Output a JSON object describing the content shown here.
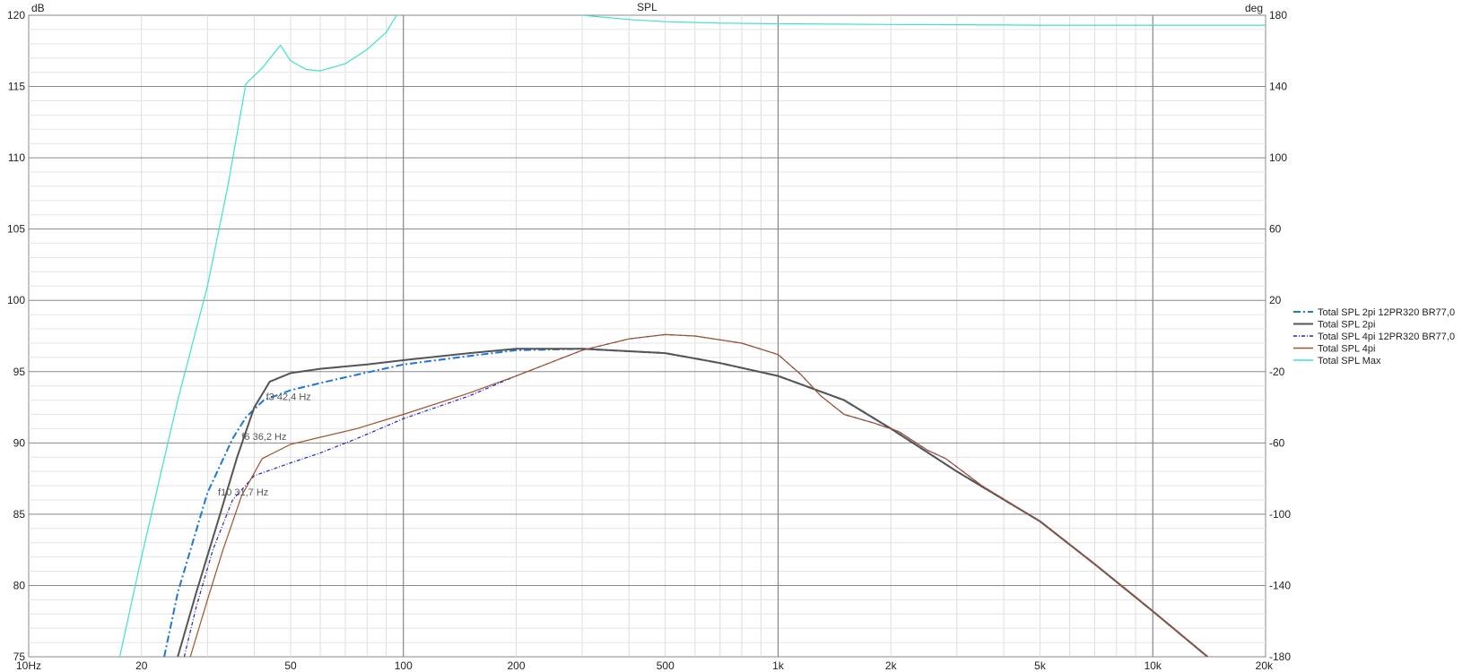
{
  "chart_data": {
    "type": "line",
    "title": "SPL",
    "ylabel": "dB",
    "y2label": "deg",
    "xscale": "log",
    "xlim": [
      10,
      20000
    ],
    "ylim": [
      75,
      120
    ],
    "y2lim": [
      -180,
      180
    ],
    "grid": true,
    "legend_position": "right",
    "x_ticks": [
      {
        "v": 10,
        "label": "10Hz"
      },
      {
        "v": 20,
        "label": "20"
      },
      {
        "v": 50,
        "label": "50"
      },
      {
        "v": 100,
        "label": "100"
      },
      {
        "v": 200,
        "label": "200"
      },
      {
        "v": 500,
        "label": "500"
      },
      {
        "v": 1000,
        "label": "1k"
      },
      {
        "v": 2000,
        "label": "2k"
      },
      {
        "v": 5000,
        "label": "5k"
      },
      {
        "v": 10000,
        "label": "10k"
      },
      {
        "v": 20000,
        "label": "20k"
      }
    ],
    "y_ticks": [
      {
        "v": 120,
        "label": "120"
      },
      {
        "v": 115,
        "label": "115"
      },
      {
        "v": 110,
        "label": "110"
      },
      {
        "v": 105,
        "label": "105"
      },
      {
        "v": 100,
        "label": "100"
      },
      {
        "v": 95,
        "label": "95"
      },
      {
        "v": 90,
        "label": "90"
      },
      {
        "v": 85,
        "label": "85"
      },
      {
        "v": 80,
        "label": "80"
      },
      {
        "v": 75,
        "label": "75"
      }
    ],
    "y2_ticks": [
      {
        "v": 180,
        "label": "180"
      },
      {
        "v": 140,
        "label": "140"
      },
      {
        "v": 100,
        "label": "100"
      },
      {
        "v": 60,
        "label": "60"
      },
      {
        "v": 20,
        "label": "20"
      },
      {
        "v": -20,
        "label": "-20"
      },
      {
        "v": -60,
        "label": "-60"
      },
      {
        "v": -100,
        "label": "-100"
      },
      {
        "v": -140,
        "label": "-140"
      },
      {
        "v": -180,
        "label": "-180"
      }
    ],
    "annotations": [
      {
        "text": "f3 42,4 Hz",
        "x": 43,
        "y": 93.0
      },
      {
        "text": "f6 36,2 Hz",
        "x": 37,
        "y": 90.2
      },
      {
        "text": "f10 31,7 Hz",
        "x": 32,
        "y": 86.3
      }
    ],
    "series": [
      {
        "name": "Total SPL 2pi 12PR320 BR77,0",
        "color": "#1f77d4",
        "dash": "8,3,2,3",
        "width": 2,
        "points": [
          [
            23,
            75
          ],
          [
            25,
            79.5
          ],
          [
            30,
            86.5
          ],
          [
            35,
            90.3
          ],
          [
            38,
            91.8
          ],
          [
            42.4,
            93.0
          ],
          [
            50,
            93.7
          ],
          [
            60,
            94.2
          ],
          [
            70,
            94.6
          ],
          [
            100,
            95.5
          ],
          [
            150,
            96.1
          ],
          [
            200,
            96.5
          ],
          [
            300,
            96.6
          ],
          [
            500,
            96.3
          ],
          [
            700,
            95.6
          ],
          [
            1000,
            94.7
          ],
          [
            1500,
            93.0
          ],
          [
            2000,
            91.0
          ],
          [
            3000,
            88.0
          ],
          [
            5000,
            84.5
          ],
          [
            7000,
            81.5
          ],
          [
            10000,
            78.2
          ],
          [
            14000,
            75
          ]
        ]
      },
      {
        "name": "Total SPL 2pi",
        "color": "#555555",
        "dash": "",
        "width": 2,
        "points": [
          [
            25,
            75
          ],
          [
            28,
            79.5
          ],
          [
            32,
            84.5
          ],
          [
            36,
            89.0
          ],
          [
            40,
            92.5
          ],
          [
            44,
            94.3
          ],
          [
            50,
            94.9
          ],
          [
            60,
            95.2
          ],
          [
            80,
            95.5
          ],
          [
            100,
            95.8
          ],
          [
            150,
            96.3
          ],
          [
            200,
            96.6
          ],
          [
            300,
            96.6
          ],
          [
            500,
            96.3
          ],
          [
            700,
            95.6
          ],
          [
            1000,
            94.7
          ],
          [
            1500,
            93.0
          ],
          [
            2000,
            91.0
          ],
          [
            3000,
            88.0
          ],
          [
            5000,
            84.5
          ],
          [
            7000,
            81.5
          ],
          [
            10000,
            78.2
          ],
          [
            14000,
            75
          ]
        ]
      },
      {
        "name": "Total SPL 4pi 12PR320 BR77,0",
        "color": "#2222cc",
        "dash": "4,2,1,2",
        "width": 1.2,
        "points": [
          [
            26,
            75
          ],
          [
            28,
            78.5
          ],
          [
            31,
            82.5
          ],
          [
            35,
            86.0
          ],
          [
            40,
            87.7
          ],
          [
            50,
            88.6
          ],
          [
            60,
            89.3
          ],
          [
            75,
            90.3
          ],
          [
            100,
            91.7
          ],
          [
            150,
            93.3
          ],
          [
            200,
            94.7
          ],
          [
            300,
            96.5
          ],
          [
            400,
            97.3
          ],
          [
            500,
            97.6
          ],
          [
            600,
            97.5
          ],
          [
            800,
            97.0
          ],
          [
            1000,
            96.2
          ],
          [
            1150,
            94.8
          ],
          [
            1300,
            93.3
          ],
          [
            1500,
            92.0
          ],
          [
            1800,
            91.4
          ],
          [
            2100,
            90.8
          ],
          [
            2500,
            89.5
          ],
          [
            2800,
            88.9
          ],
          [
            3500,
            87.0
          ],
          [
            5000,
            84.5
          ],
          [
            7000,
            81.5
          ],
          [
            10000,
            78.2
          ],
          [
            14000,
            75
          ]
        ]
      },
      {
        "name": "Total SPL 4pi",
        "color": "#a0522d",
        "dash": "",
        "width": 1.2,
        "points": [
          [
            27,
            75
          ],
          [
            30,
            79.0
          ],
          [
            33,
            82.5
          ],
          [
            37,
            86.3
          ],
          [
            42,
            88.9
          ],
          [
            50,
            89.9
          ],
          [
            60,
            90.4
          ],
          [
            75,
            91.0
          ],
          [
            100,
            92.0
          ],
          [
            150,
            93.5
          ],
          [
            200,
            94.7
          ],
          [
            300,
            96.5
          ],
          [
            400,
            97.3
          ],
          [
            500,
            97.6
          ],
          [
            600,
            97.5
          ],
          [
            800,
            97.0
          ],
          [
            1000,
            96.2
          ],
          [
            1150,
            94.8
          ],
          [
            1300,
            93.3
          ],
          [
            1500,
            92.0
          ],
          [
            1800,
            91.4
          ],
          [
            2100,
            90.8
          ],
          [
            2500,
            89.5
          ],
          [
            2800,
            88.9
          ],
          [
            3500,
            87.0
          ],
          [
            5000,
            84.5
          ],
          [
            7000,
            81.5
          ],
          [
            10000,
            78.2
          ],
          [
            14000,
            75
          ]
        ]
      },
      {
        "name": "Total SPL Max",
        "color": "#40e0d0",
        "dash": "",
        "width": 1.2,
        "points": [
          [
            17.5,
            75
          ],
          [
            20,
            82
          ],
          [
            25,
            93
          ],
          [
            30,
            101
          ],
          [
            34,
            108
          ],
          [
            37,
            113.5
          ],
          [
            38,
            115.2
          ],
          [
            42,
            116.3
          ],
          [
            47,
            117.9
          ],
          [
            50,
            116.8
          ],
          [
            55,
            116.2
          ],
          [
            60,
            116.1
          ],
          [
            70,
            116.6
          ],
          [
            80,
            117.6
          ],
          [
            90,
            118.8
          ],
          [
            96,
            120
          ]
        ],
        "points2": [
          [
            300,
            120
          ],
          [
            400,
            119.7
          ],
          [
            500,
            119.55
          ],
          [
            700,
            119.45
          ],
          [
            1000,
            119.4
          ],
          [
            2000,
            119.35
          ],
          [
            5000,
            119.3
          ],
          [
            10000,
            119.3
          ],
          [
            20000,
            119.3
          ]
        ]
      }
    ]
  }
}
